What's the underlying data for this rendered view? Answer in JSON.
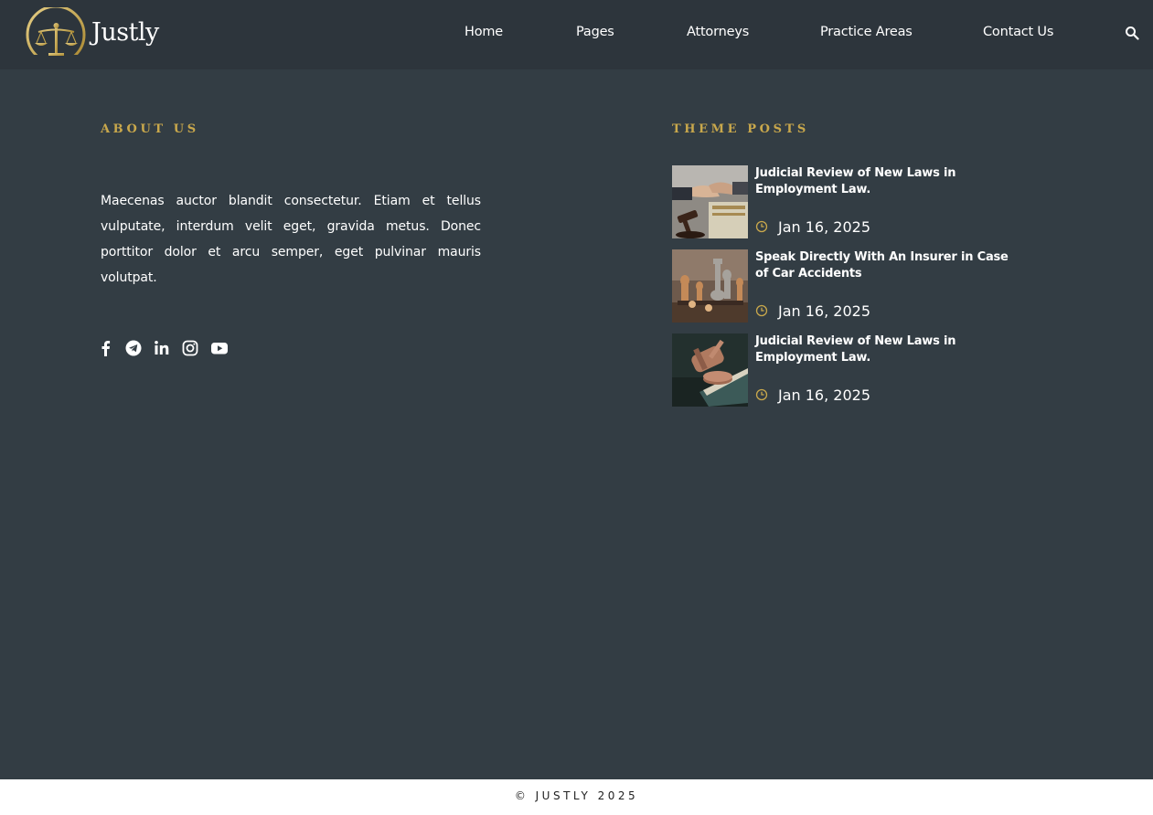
{
  "header": {
    "brand": "Justly",
    "nav": [
      "Home",
      "Pages",
      "Attorneys",
      "Practice Areas",
      "Contact Us"
    ],
    "search_icon": "search-icon",
    "accent_color": "#c9a84c",
    "background_color": "#2d353c"
  },
  "about": {
    "heading": "ABOUT US",
    "text": "Maecenas auctor blandit consectetur. Etiam et tellus vulputate, interdum velit eget, gravida metus. Donec porttitor dolor et arcu semper, eget pulvinar mauris volutpat.",
    "socials": [
      "facebook-icon",
      "telegram-icon",
      "linkedin-icon",
      "instagram-icon",
      "youtube-icon"
    ]
  },
  "posts": {
    "heading": "THEME POSTS",
    "items": [
      {
        "title": "Judicial Review of New Laws in Employment Law.",
        "date": "Jan 16, 2025",
        "thumb": "handshake-gavel-image"
      },
      {
        "title": "Speak Directly With An Insurer in Case of Car Accidents",
        "date": "Jan 16, 2025",
        "thumb": "chess-pieces-image"
      },
      {
        "title": "Judicial Review of New Laws in Employment Law.",
        "date": "Jan 16, 2025",
        "thumb": "gavel-books-image"
      }
    ]
  },
  "footer": {
    "copyright": "© JUSTLY 2025",
    "background_color": "#ffffff"
  },
  "page_background": "#333d44"
}
